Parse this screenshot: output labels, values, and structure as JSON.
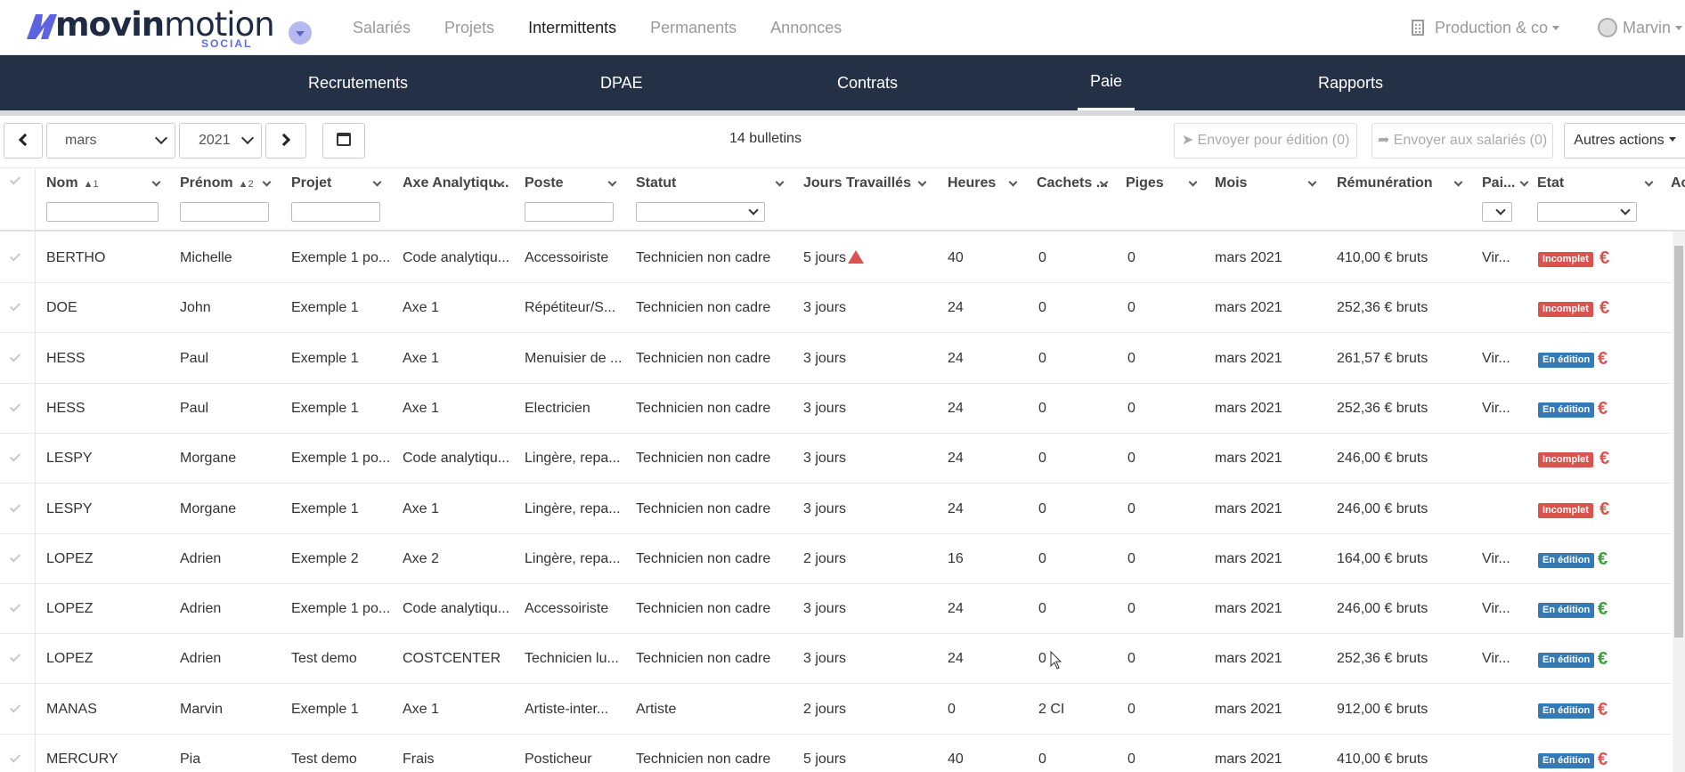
{
  "logo": {
    "brand_bold": "movin",
    "brand_light": "motion",
    "tagline": "SOCIAL"
  },
  "main_nav": [
    {
      "label": "Salariés",
      "active": false
    },
    {
      "label": "Projets",
      "active": false
    },
    {
      "label": "Intermittents",
      "active": true
    },
    {
      "label": "Permanents",
      "active": false
    },
    {
      "label": "Annonces",
      "active": false
    }
  ],
  "company": "Production & co",
  "user": "Marvin",
  "sub_nav": [
    {
      "label": "Recrutements",
      "active": false
    },
    {
      "label": "DPAE",
      "active": false
    },
    {
      "label": "Contrats",
      "active": false
    },
    {
      "label": "Paie",
      "active": true
    },
    {
      "label": "Rapports",
      "active": false
    }
  ],
  "toolbar": {
    "month": "mars",
    "year": "2021",
    "count": "14 bulletins",
    "send_edit": "Envoyer pour édition (0)",
    "send_employees": "Envoyer aux salariés (0)",
    "other_actions": "Autres actions"
  },
  "columns": {
    "nom": "Nom",
    "nom_sort": "▲1",
    "prenom": "Prénom",
    "prenom_sort": "▲2",
    "projet": "Projet",
    "axe": "Axe Analytiqu...",
    "poste": "Poste",
    "statut": "Statut",
    "jours": "Jours Travaillés",
    "heures": "Heures",
    "cachets": "Cachets ...",
    "piges": "Piges",
    "mois": "Mois",
    "remuneration": "Rémunération",
    "paiement": "Pai...",
    "etat": "Etat",
    "actions": "Ac"
  },
  "rows": [
    {
      "nom": "BERTHO",
      "prenom": "Michelle",
      "projet": "Exemple 1 po...",
      "axe": "Code analytiqu...",
      "poste": "Accessoiriste",
      "statut": "Technicien non cadre",
      "jours": "5 jours",
      "warn": true,
      "heures": "40",
      "cachets": "0",
      "piges": "0",
      "mois": "mars 2021",
      "remuneration": "410,00 € bruts",
      "paiement": "Vir...",
      "etat": "Incomplet",
      "etat_type": "inc",
      "euro": "€",
      "euro_color": "#d9534f"
    },
    {
      "nom": "DOE",
      "prenom": "John",
      "projet": "Exemple 1",
      "axe": "Axe 1",
      "poste": "Répétiteur/S...",
      "statut": "Technicien non cadre",
      "jours": "3 jours",
      "warn": false,
      "heures": "24",
      "cachets": "0",
      "piges": "0",
      "mois": "mars 2021",
      "remuneration": "252,36 € bruts",
      "paiement": "",
      "etat": "Incomplet",
      "etat_type": "inc",
      "euro": "€",
      "euro_color": "#d9534f"
    },
    {
      "nom": "HESS",
      "prenom": "Paul",
      "projet": "Exemple 1",
      "axe": "Axe 1",
      "poste": "Menuisier de ...",
      "statut": "Technicien non cadre",
      "jours": "3 jours",
      "warn": false,
      "heures": "24",
      "cachets": "0",
      "piges": "0",
      "mois": "mars 2021",
      "remuneration": "261,57 € bruts",
      "paiement": "Vir...",
      "etat": "En édition",
      "etat_type": "edi",
      "euro": "€",
      "euro_color": "#d9534f"
    },
    {
      "nom": "HESS",
      "prenom": "Paul",
      "projet": "Exemple 1",
      "axe": "Axe 1",
      "poste": "Electricien",
      "statut": "Technicien non cadre",
      "jours": "3 jours",
      "warn": false,
      "heures": "24",
      "cachets": "0",
      "piges": "0",
      "mois": "mars 2021",
      "remuneration": "252,36 € bruts",
      "paiement": "Vir...",
      "etat": "En édition",
      "etat_type": "edi",
      "euro": "€",
      "euro_color": "#d9534f"
    },
    {
      "nom": "LESPY",
      "prenom": "Morgane",
      "projet": "Exemple 1 po...",
      "axe": "Code analytiqu...",
      "poste": "Lingère, repa...",
      "statut": "Technicien non cadre",
      "jours": "3 jours",
      "warn": false,
      "heures": "24",
      "cachets": "0",
      "piges": "0",
      "mois": "mars 2021",
      "remuneration": "246,00 € bruts",
      "paiement": "",
      "etat": "Incomplet",
      "etat_type": "inc",
      "euro": "€",
      "euro_color": "#d9534f"
    },
    {
      "nom": "LESPY",
      "prenom": "Morgane",
      "projet": "Exemple 1",
      "axe": "Axe 1",
      "poste": "Lingère, repa...",
      "statut": "Technicien non cadre",
      "jours": "3 jours",
      "warn": false,
      "heures": "24",
      "cachets": "0",
      "piges": "0",
      "mois": "mars 2021",
      "remuneration": "246,00 € bruts",
      "paiement": "",
      "etat": "Incomplet",
      "etat_type": "inc",
      "euro": "€",
      "euro_color": "#d9534f"
    },
    {
      "nom": "LOPEZ",
      "prenom": "Adrien",
      "projet": "Exemple 2",
      "axe": "Axe 2",
      "poste": "Lingère, repa...",
      "statut": "Technicien non cadre",
      "jours": "2 jours",
      "warn": false,
      "heures": "16",
      "cachets": "0",
      "piges": "0",
      "mois": "mars 2021",
      "remuneration": "164,00 € bruts",
      "paiement": "Vir...",
      "etat": "En édition",
      "etat_type": "edi",
      "euro": "€",
      "euro_color": "#3c9b3c"
    },
    {
      "nom": "LOPEZ",
      "prenom": "Adrien",
      "projet": "Exemple 1 po...",
      "axe": "Code analytiqu...",
      "poste": "Accessoiriste",
      "statut": "Technicien non cadre",
      "jours": "3 jours",
      "warn": false,
      "heures": "24",
      "cachets": "0",
      "piges": "0",
      "mois": "mars 2021",
      "remuneration": "246,00 € bruts",
      "paiement": "Vir...",
      "etat": "En édition",
      "etat_type": "edi",
      "euro": "€",
      "euro_color": "#3c9b3c"
    },
    {
      "nom": "LOPEZ",
      "prenom": "Adrien",
      "projet": "Test demo",
      "axe": "COSTCENTER",
      "poste": "Technicien lu...",
      "statut": "Technicien non cadre",
      "jours": "3 jours",
      "warn": false,
      "heures": "24",
      "cachets": "0",
      "piges": "0",
      "mois": "mars 2021",
      "remuneration": "252,36 € bruts",
      "paiement": "Vir...",
      "etat": "En édition",
      "etat_type": "edi",
      "euro": "€",
      "euro_color": "#3c9b3c"
    },
    {
      "nom": "MANAS",
      "prenom": "Marvin",
      "projet": "Exemple 1",
      "axe": "Axe 1",
      "poste": "Artiste-inter...",
      "statut": "Artiste",
      "jours": "2 jours",
      "warn": false,
      "heures": "0",
      "cachets": "2 CI",
      "piges": "0",
      "mois": "mars 2021",
      "remuneration": "912,00 € bruts",
      "paiement": "",
      "etat": "En édition",
      "etat_type": "edi",
      "euro": "€",
      "euro_color": "#d9534f"
    },
    {
      "nom": "MERCURY",
      "prenom": "Pia",
      "projet": "Test demo",
      "axe": "Frais",
      "poste": "Posticheur",
      "statut": "Technicien non cadre",
      "jours": "5 jours",
      "warn": false,
      "heures": "40",
      "cachets": "0",
      "piges": "0",
      "mois": "mars 2021",
      "remuneration": "410,00 € bruts",
      "paiement": "",
      "etat": "En édition",
      "etat_type": "edi",
      "euro": "€",
      "euro_color": "#d9534f"
    }
  ]
}
